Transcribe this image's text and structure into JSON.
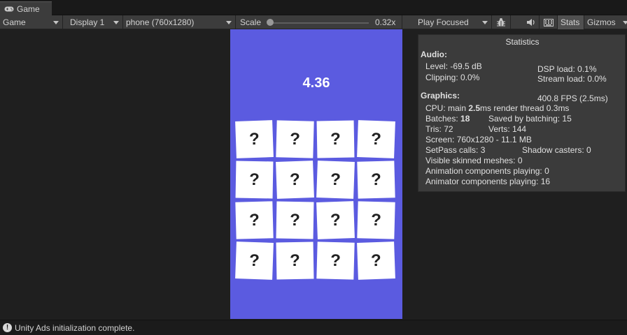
{
  "tab": {
    "label": "Game",
    "icon": "gamepad-icon"
  },
  "toolbar": {
    "mode": "Game",
    "display": "Display 1",
    "resolution": "phone (760x1280)",
    "scale_label": "Scale",
    "scale_value": "0.32x",
    "scale_fraction": 0.0,
    "play_mode": "Play Focused",
    "stats_label": "Stats",
    "gizmos_label": "Gizmos"
  },
  "game": {
    "timer": "4.36",
    "background_color": "#5b5be0",
    "cards": [
      "?",
      "?",
      "?",
      "?",
      "?",
      "?",
      "?",
      "?",
      "?",
      "?",
      "?",
      "?",
      "?",
      "?",
      "?",
      "?"
    ]
  },
  "stats": {
    "title": "Statistics",
    "audio_header": "Audio:",
    "level": "Level: -69.5 dB",
    "dsp_load": "DSP load: 0.1%",
    "clipping": "Clipping: 0.0%",
    "stream_load": "Stream load: 0.0%",
    "graphics_header": "Graphics:",
    "fps": "400.8 FPS (2.5ms)",
    "cpu_prefix": "CPU: main ",
    "cpu_main": "2.5",
    "cpu_suffix": "ms  render thread 0.3ms",
    "batches_prefix": "Batches: ",
    "batches": "18",
    "saved_by_batching": "Saved by batching: 15",
    "tris": "Tris: 72",
    "verts": "Verts: 144",
    "screen": "Screen: 760x1280 - 11.1 MB",
    "setpass": "SetPass calls: 3",
    "shadow_casters": "Shadow casters: 0",
    "skinned_meshes": "Visible skinned meshes: 0",
    "animation_components": "Animation components playing: 0",
    "animator_components": "Animator components playing: 16"
  },
  "status": {
    "message": "Unity Ads initialization complete."
  }
}
